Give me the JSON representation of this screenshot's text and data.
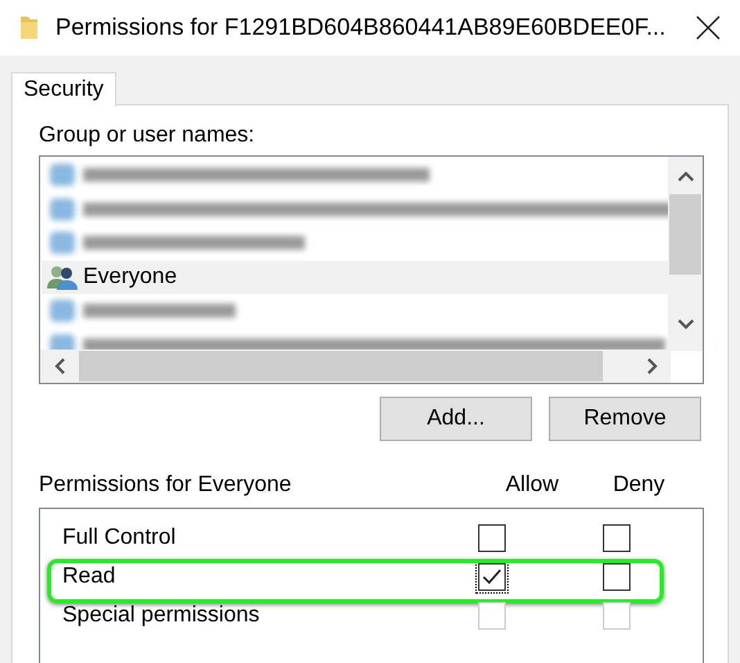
{
  "window": {
    "title": "Permissions for F1291BD604B860441AB89E60BDEE0F..."
  },
  "tabs": [
    {
      "label": "Security",
      "selected": true
    }
  ],
  "group_list": {
    "label": "Group or user names:",
    "items": [
      {
        "kind": "redacted",
        "selected": false
      },
      {
        "kind": "redacted",
        "selected": false
      },
      {
        "kind": "redacted",
        "selected": false
      },
      {
        "kind": "group",
        "name": "Everyone",
        "selected": true
      },
      {
        "kind": "redacted",
        "selected": false
      },
      {
        "kind": "redacted",
        "selected": false
      }
    ]
  },
  "buttons": [
    "Add...",
    "Remove"
  ],
  "permissions": {
    "label": "Permissions for Everyone",
    "columns": [
      "Allow",
      "Deny"
    ],
    "rows": [
      {
        "name": "Full Control",
        "allow": false,
        "deny": false,
        "disabled": false,
        "focused": false,
        "highlighted": false
      },
      {
        "name": "Read",
        "allow": true,
        "deny": false,
        "disabled": false,
        "focused": true,
        "highlighted": true
      },
      {
        "name": "Special permissions",
        "allow": false,
        "deny": false,
        "disabled": true,
        "focused": false,
        "highlighted": false
      }
    ]
  }
}
